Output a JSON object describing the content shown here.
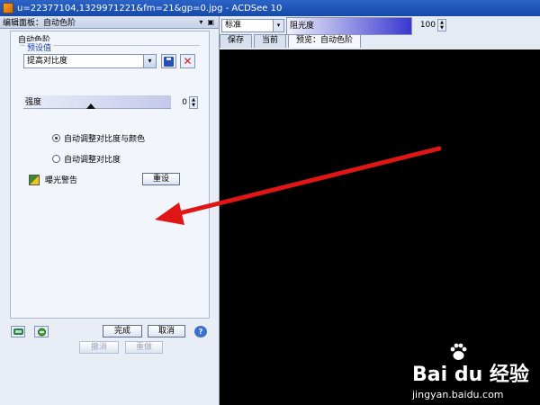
{
  "window": {
    "title": "u=22377104,1329971221&fm=21&gp=0.jpg - ACDSee 10"
  },
  "panel": {
    "header": "编辑面板：自动色阶",
    "header_controls": [
      "▾",
      "▣"
    ],
    "group_title": "自动色阶",
    "preset": {
      "title": "预设值",
      "value": "提高对比度",
      "arrow": "▾",
      "delete_label": "✕"
    },
    "strength": {
      "label": "强度",
      "value": "0"
    },
    "radios": [
      {
        "label": "自动调整对比度与颜色",
        "selected": true
      },
      {
        "label": "自动调整对比度",
        "selected": false
      }
    ],
    "exposure_warning_label": "曝光警告",
    "reset_label": "重设",
    "help_label": "?",
    "done_label": "完成",
    "cancel_label": "取消",
    "undo_label": "撤消",
    "redo_label": "重做"
  },
  "toolbar": {
    "mode_value": "标准",
    "mode_arrow": "▾",
    "opacity_label": "阻光度",
    "opacity_value": "100",
    "spin_up": "▲",
    "spin_down": "▼"
  },
  "tabs": [
    {
      "label": "保存",
      "active": false
    },
    {
      "label": "当前",
      "active": false
    },
    {
      "label": "预览：自动色阶",
      "active": true
    }
  ],
  "watermark": {
    "logo": "Bai du 经验",
    "url": "jingyan.baidu.com"
  },
  "colors": {
    "arrow": "#e01515",
    "title_bar": "#1f55b8",
    "preview_bg": "#000000"
  }
}
